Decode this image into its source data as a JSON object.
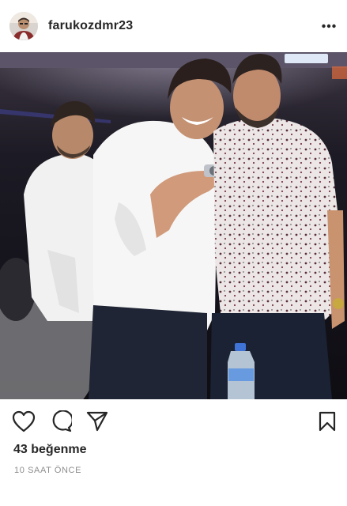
{
  "post": {
    "username": "farukozdmr23",
    "likes_text": "43 beğenme",
    "time_text": "10 SAAT ÖNCE"
  },
  "icons": {
    "more": "more-horizontal-icon",
    "like": "heart-icon",
    "comment": "comment-icon",
    "share": "paper-plane-icon",
    "save": "bookmark-icon"
  },
  "colors": {
    "text": "#262626",
    "muted": "#8e8e8e",
    "background": "#ffffff"
  }
}
